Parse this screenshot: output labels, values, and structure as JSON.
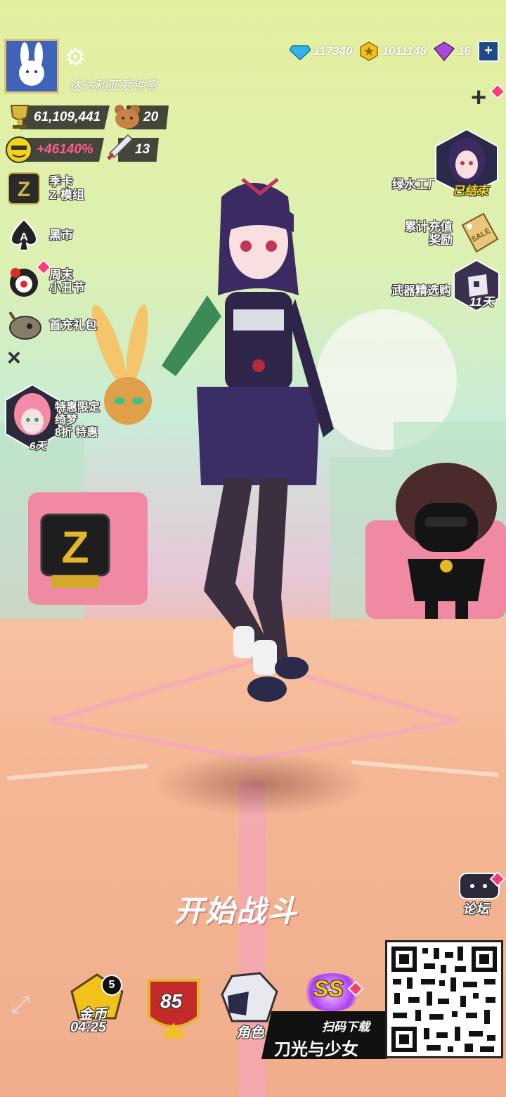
{
  "currencies": {
    "diamonds": "117340",
    "gold": "1011148",
    "gems": "16",
    "add_label": "+"
  },
  "profile": {
    "username": "达达利亚爱钟离",
    "trophies": "61,109,441",
    "pets": "20",
    "bonus": "+46140%",
    "weapons": "13"
  },
  "left_menu": [
    {
      "line1": "季卡",
      "line2": "Z-模组"
    },
    {
      "line1": "黑市",
      "line2": ""
    },
    {
      "line1": "周末",
      "line2": "小丑节"
    },
    {
      "line1": "首充礼包",
      "line2": ""
    }
  ],
  "close_label": "×",
  "promo_character": {
    "line1": "特惠限定",
    "line2": "绮梦",
    "line3": "8折 特惠",
    "days": "6天"
  },
  "right_menu": [
    {
      "line1": "绿水工厂",
      "status": "已结束"
    },
    {
      "line1": "累计充值",
      "line2": "奖励",
      "tag": "SALE"
    },
    {
      "line1": "武器精选购",
      "days": "11天"
    }
  ],
  "add_button": "+",
  "start_button": "开始战斗",
  "forum_label": "论坛",
  "bottom_bar": {
    "gold_label": "金币",
    "gold_timer": "04:25",
    "gold_count": "5",
    "level": "85",
    "role_label": "角色",
    "ss_label": "SS"
  },
  "download": {
    "scan": "扫码下载",
    "title": "刀光与少女"
  },
  "colors": {
    "diamond": "#2fb5e8",
    "gold": "#f2c21a",
    "gem": "#a64ad6",
    "accent": "#ff3d6e"
  }
}
